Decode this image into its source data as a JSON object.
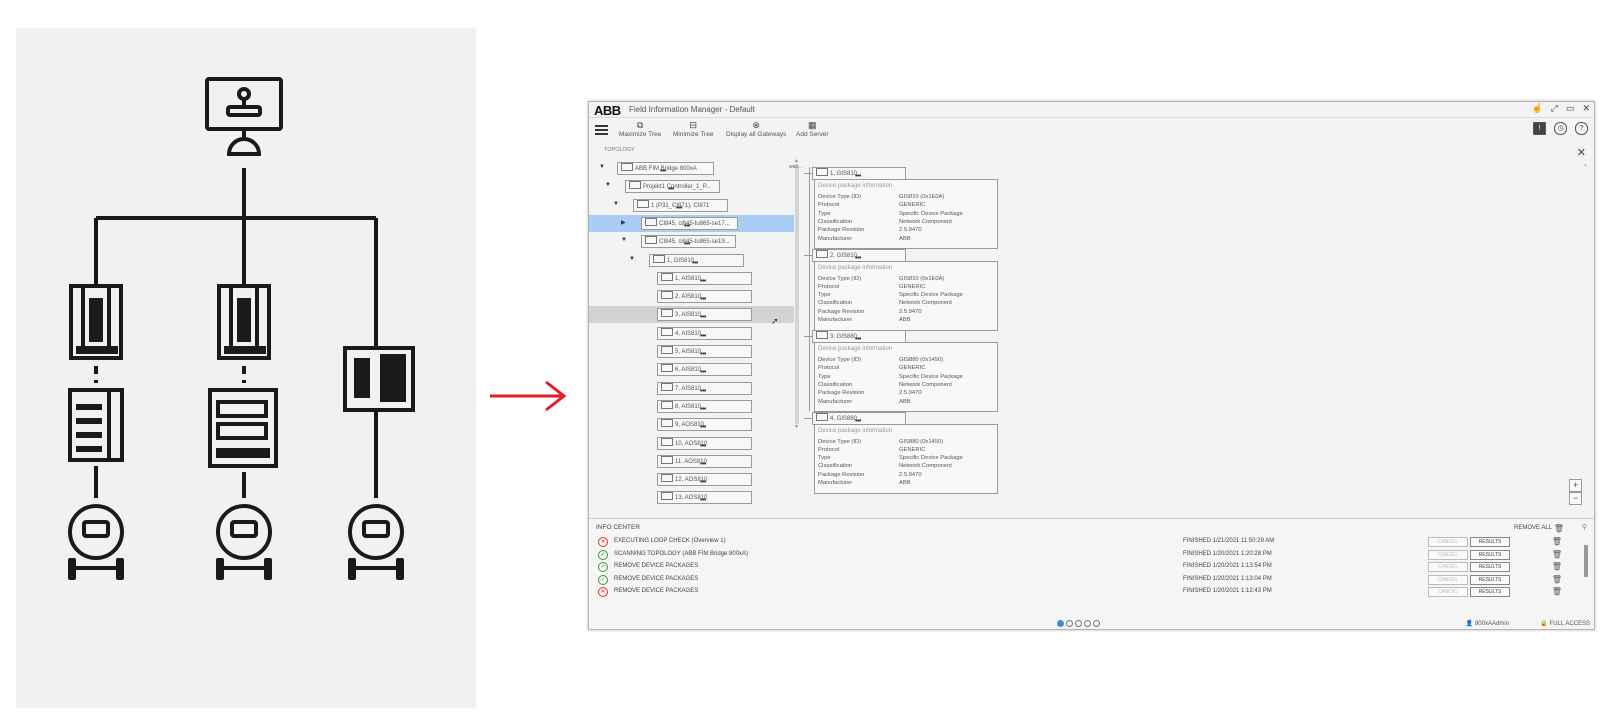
{
  "arrow_color": "#e31e24",
  "accent_color": "#3b8de0",
  "app": {
    "logo": "ABB",
    "title": "Field Information Manager - Default",
    "window_buttons": [
      "☝",
      "⤢",
      "▭",
      "✕"
    ]
  },
  "toolbar": {
    "items": [
      {
        "label": "Maximize Tree",
        "icon": "maximize-tree-icon",
        "glyph": "⧉"
      },
      {
        "label": "Minimize Tree",
        "icon": "minimize-tree-icon",
        "glyph": "⊟"
      },
      {
        "label": "Display all Gateways",
        "icon": "gateway-icon",
        "glyph": "⊗"
      },
      {
        "label": "Add Server",
        "icon": "server-icon",
        "glyph": "▦"
      }
    ],
    "right_icons": [
      "!",
      "◷",
      "?"
    ]
  },
  "topology": {
    "label": "TOPOLOGY",
    "tree": [
      {
        "label": "ABB FIM Bridge 800xA",
        "caret": "▼",
        "state": ""
      },
      {
        "label": "Projekt1 Controller_1_P...",
        "caret": "▼",
        "state": ""
      },
      {
        "label": "1 (P31_CI871), CI871",
        "caret": "▼",
        "state": ""
      },
      {
        "label": "CI845, ci845-tu865-se17...",
        "caret": "▶",
        "state": "selected"
      },
      {
        "label": "CI845, ci845-tu865-se19...",
        "caret": "▼",
        "state": ""
      },
      {
        "label": "1, GIS810",
        "caret": "▼",
        "state": ""
      },
      {
        "label": "1, AIS810",
        "caret": "",
        "state": ""
      },
      {
        "label": "2, AIS810",
        "caret": "",
        "state": ""
      },
      {
        "label": "3, AIS810",
        "caret": "",
        "state": "hover"
      },
      {
        "label": "4, AIS810",
        "caret": "",
        "state": ""
      },
      {
        "label": "5, AIS810",
        "caret": "",
        "state": ""
      },
      {
        "label": "6, AIS810",
        "caret": "",
        "state": ""
      },
      {
        "label": "7, AIS810",
        "caret": "",
        "state": ""
      },
      {
        "label": "8, AIS810",
        "caret": "",
        "state": ""
      },
      {
        "label": "9, AOS810",
        "caret": "",
        "state": ""
      },
      {
        "label": "10, AOS810",
        "caret": "",
        "state": ""
      },
      {
        "label": "11, AOS810",
        "caret": "",
        "state": ""
      },
      {
        "label": "12, AOS810",
        "caret": "",
        "state": ""
      },
      {
        "label": "13, AOS810",
        "caret": "",
        "state": ""
      }
    ],
    "root_tag": "was..."
  },
  "details": {
    "section_title": "Device package information",
    "field_labels": [
      "Device Type (ID)",
      "Protocol",
      "Type",
      "Classification",
      "Package Revision",
      "Manufacturer"
    ],
    "cards": [
      {
        "title": "1, GIS810",
        "values": [
          "GIS810 (0x1E0A)",
          "GENERIC",
          "Specific Device Package",
          "Network Component",
          "2.5.9470",
          "ABB"
        ]
      },
      {
        "title": "2, GIS810",
        "values": [
          "GIS810 (0x1E0A)",
          "GENERIC",
          "Specific Device Package",
          "Network Component",
          "2.5.9470",
          "ABB"
        ]
      },
      {
        "title": "3, GIS880",
        "values": [
          "GIS880 (0x1450)",
          "GENERIC",
          "Specific Device Package",
          "Network Component",
          "2.5.9470",
          "ABB"
        ]
      },
      {
        "title": "4, GIS880",
        "values": [
          "GIS880 (0x1450)",
          "GENERIC",
          "Specific Device Package",
          "Network Component",
          "2.5.9470",
          "ABB"
        ]
      }
    ],
    "zoom_in": "+",
    "zoom_out": "−"
  },
  "info_center": {
    "title": "INFO CENTER",
    "remove_all": "REMOVE ALL",
    "cancel_label": "CANCEL",
    "results_label": "RESULTS",
    "rows": [
      {
        "status": "error",
        "glyph": "✕",
        "name": "EXECUTING LOOP CHECK (Overview 1)",
        "time": "FINISHED 1/21/2021 11:50:29 AM"
      },
      {
        "status": "ok",
        "glyph": "✓",
        "name": "SCANNING TOPOLOGY (ABB FIM Bridge 800xA)",
        "time": "FINISHED 1/20/2021 1:20:28 PM"
      },
      {
        "status": "ok",
        "glyph": "✓",
        "name": "REMOVE DEVICE PACKAGES",
        "time": "FINISHED 1/20/2021 1:13:54 PM"
      },
      {
        "status": "ok",
        "glyph": "✓",
        "name": "REMOVE DEVICE PACKAGES",
        "time": "FINISHED 1/20/2021 1:13:04 PM"
      },
      {
        "status": "error",
        "glyph": "✕",
        "name": "REMOVE DEVICE PACKAGES",
        "time": "FINISHED 1/20/2021 1:12:43 PM"
      }
    ]
  },
  "status_bar": {
    "pages": 5,
    "active_page": 1,
    "user": "800xAAdmin",
    "access": "FULL ACCESS"
  }
}
